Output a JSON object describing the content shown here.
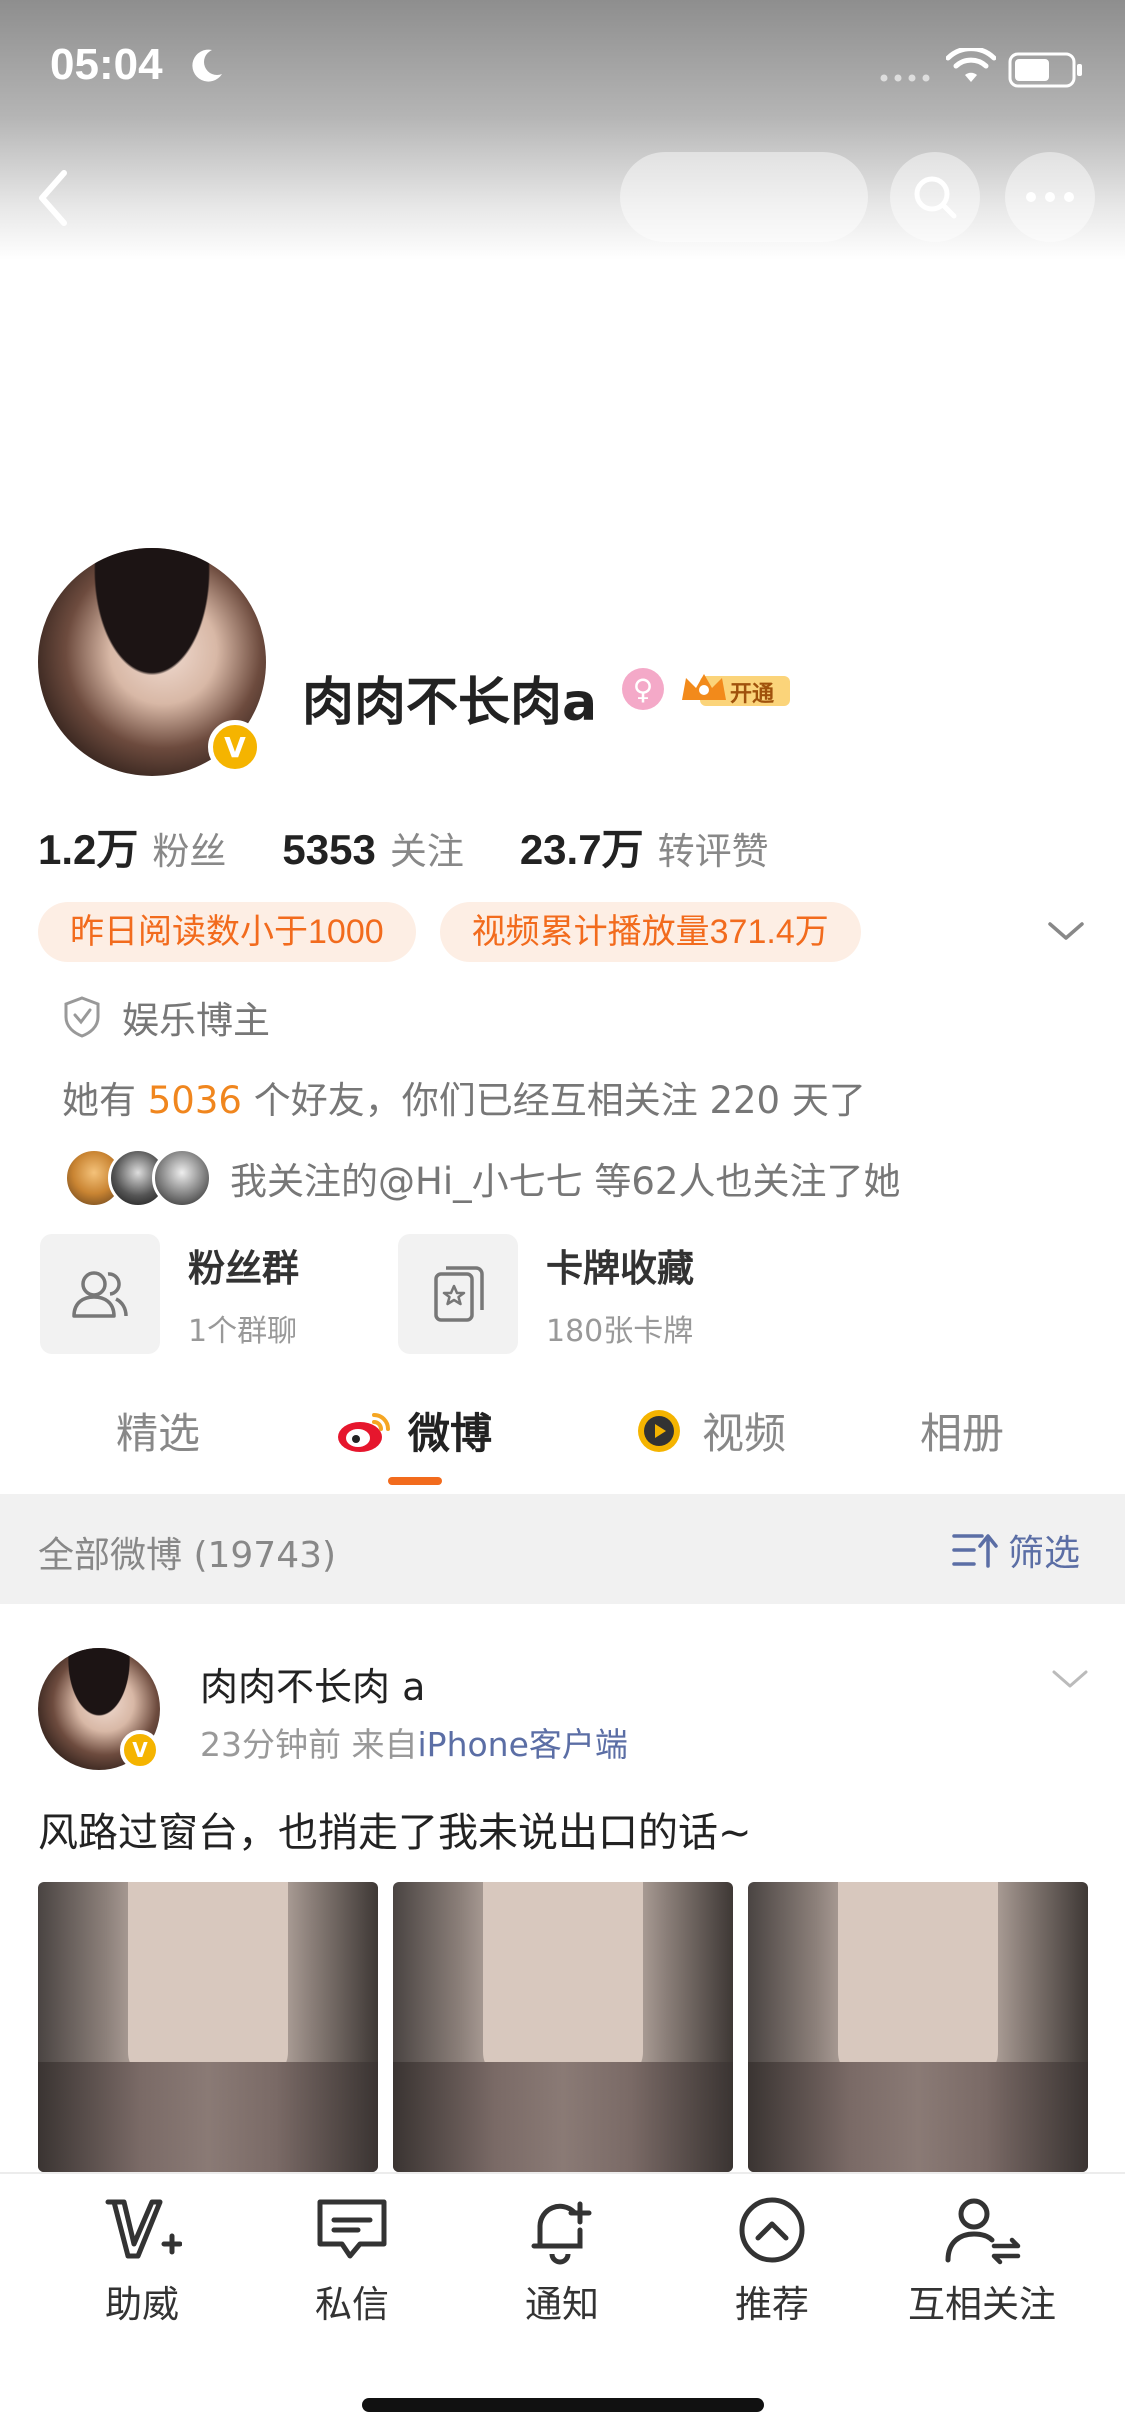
{
  "status": {
    "time": "05:04"
  },
  "profile": {
    "nickname": "肉肉不长肉a",
    "vip_label": "开通",
    "verify_mark": "V",
    "stats": [
      {
        "num": "1.2万",
        "label": "粉丝"
      },
      {
        "num": "5353",
        "label": "关注"
      },
      {
        "num": "23.7万",
        "label": "转评赞"
      }
    ],
    "tags": [
      "昨日阅读数小于1000",
      "视频累计播放量371.4万"
    ],
    "certification": "娱乐博主",
    "friends": {
      "prefix": "她有 ",
      "count": "5036",
      "suffix": " 个好友，你们已经互相关注 220 天了"
    },
    "mutual_follow": "我关注的@Hi_小七七 等62人也关注了她",
    "cards": [
      {
        "title": "粉丝群",
        "sub": "1个群聊"
      },
      {
        "title": "卡牌收藏",
        "sub": "180张卡牌"
      }
    ]
  },
  "tabs": [
    "精选",
    "微博",
    "视频",
    "相册"
  ],
  "filter": {
    "count_label": "全部微博 (19743)",
    "filter_label": "筛选"
  },
  "post": {
    "name": "肉肉不长肉 a",
    "time": "23分钟前",
    "from_prefix": "  来自",
    "source": "iPhone客户端",
    "text": "风路过窗台，也捎走了我未说出口的话~"
  },
  "bottom_bar": [
    "助威",
    "私信",
    "通知",
    "推荐",
    "互相关注"
  ],
  "colors": {
    "accent": "#f26b1d",
    "link": "#5b6ea5",
    "verify": "#f5b400"
  }
}
